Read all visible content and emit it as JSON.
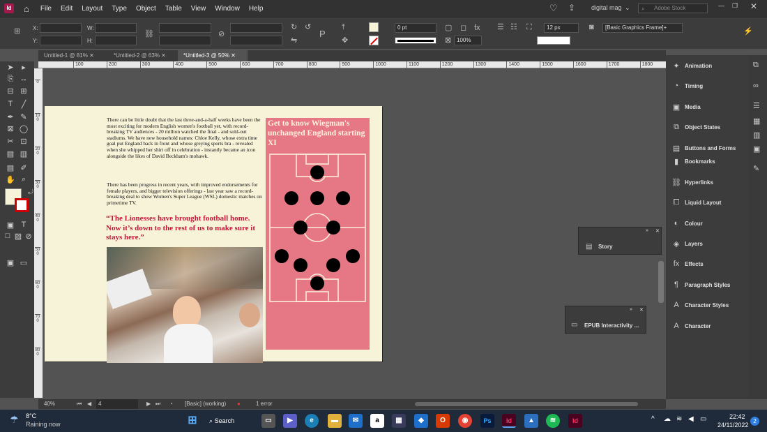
{
  "menubar": {
    "app_icon": "Id",
    "items": [
      "File",
      "Edit",
      "Layout",
      "Type",
      "Object",
      "Table",
      "View",
      "Window",
      "Help"
    ],
    "workspace": "digital mag",
    "search_placeholder": "Adobe Stock"
  },
  "control": {
    "x_label": "X:",
    "y_label": "Y:",
    "w_label": "W:",
    "h_label": "H:",
    "stroke_weight": "0 pt",
    "opacity": "100%",
    "size": "12 px",
    "object_style": "[Basic Graphics Frame]+"
  },
  "tabs": [
    "Untitled-1 @ 81%",
    "*Untitled-2 @ 63%",
    "*Untitled-3 @ 50%"
  ],
  "ruler": {
    "h": [
      "100",
      "200",
      "300",
      "400",
      "500",
      "600",
      "700",
      "800",
      "900",
      "1000",
      "1100",
      "1200",
      "1300",
      "1400",
      "1500",
      "1600",
      "1700",
      "1800"
    ],
    "v": [
      "0",
      "100",
      "200",
      "300",
      "400",
      "500",
      "600",
      "700",
      "800"
    ]
  },
  "page": {
    "body1": "There can be little doubt that the last three-and-a-half weeks have been the most exciting for modern English women's football yet, with record-breaking TV audiences - 20 million watched the final - and sold-out stadiums. We have new household names: Chloe Kelly, whose extra time goal put England back in front and whose greying sports bra - revealed when she whipped her shirt off in celebration - instantly became an icon alongside the likes of David Beckham's mohawk.",
    "body2": "There has been progress in recent years, with improved endorsements for female players, and bigger television offerings - last year saw a record-breaking deal to show Women's Super League (WSL) domestic matches on primetime TV.",
    "pull_quote": "“The Lionesses have brought football home. Now it’s down to the rest of us to make sure it stays here.”",
    "side_heading": "Get to know Wiegman's unchanged England starting XI"
  },
  "status": {
    "zoom": "40%",
    "page_number": "4",
    "preflight_profile": "[Basic] (working)",
    "errors": "1 error"
  },
  "panels": [
    "Animation",
    "Timing",
    "Media",
    "Object States",
    "Buttons and Forms",
    "Bookmarks",
    "Hyperlinks",
    "Liquid Layout",
    "Colour",
    "Layers",
    "Effects",
    "Paragraph Styles",
    "Character Styles",
    "Character"
  ],
  "floating": {
    "story": "Story",
    "epub": "EPUB Interactivity ..."
  },
  "taskbar": {
    "temp": "8°C",
    "weather": "Raining now",
    "search": "Search",
    "time": "22:42",
    "date": "24/11/2022",
    "notifications": "2"
  },
  "colors": {
    "accent_pink": "#e57884",
    "quote_red": "#c4163a",
    "page": "#f7f3d8"
  }
}
